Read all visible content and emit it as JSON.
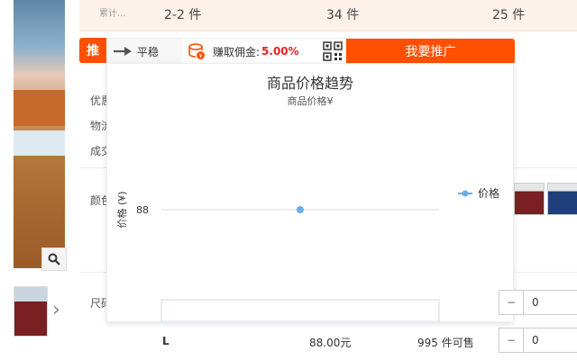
{
  "stats": {
    "col0": "累计...",
    "col1": "2-2 件",
    "col2": "34 件",
    "col3": "25 件"
  },
  "background_labels": {
    "promo": "优惠",
    "logistics": "物流",
    "sales": "成交",
    "color": "颜色",
    "size": "尺码"
  },
  "promo": {
    "tag": "推",
    "trend_label": "平稳",
    "commission_label": "赚取佣金:",
    "commission_rate": "5.00%",
    "promote_button": "我要推广"
  },
  "price_popup": {
    "title": "商品价格趋势",
    "subtitle": "商品价格¥"
  },
  "chart_data": {
    "type": "line",
    "title": "商品价格趋势",
    "subtitle": "商品价格¥",
    "ylabel": "价格 (¥)",
    "y_ticks": [
      "88"
    ],
    "series": [
      {
        "name": "价格",
        "values": [
          88
        ],
        "color": "#6aaee8"
      }
    ],
    "legend_position": "right",
    "grid": true
  },
  "sku_rows": [
    {
      "size": "L",
      "price": "88.00元",
      "stock": "995 件可售",
      "quantity": "0"
    }
  ],
  "quantity_top": "0",
  "colors": {
    "accent": "#ff5000",
    "commission": "#e4231f",
    "series": "#6aaee8"
  }
}
